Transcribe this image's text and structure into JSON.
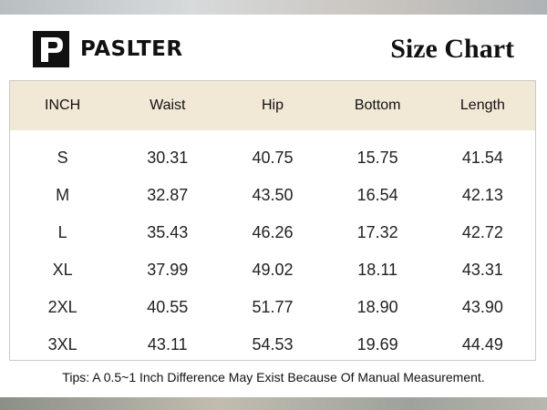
{
  "brand": {
    "name": "PASLTER",
    "logo_icon": "paslter-p-logo-icon"
  },
  "title": "Size Chart",
  "colors": {
    "header_bg": "#f2e8d6",
    "logo_bg": "#111111",
    "text": "#111111"
  },
  "table": {
    "headers": [
      "INCH",
      "Waist",
      "Hip",
      "Bottom",
      "Length"
    ],
    "rows": [
      [
        "S",
        "30.31",
        "40.75",
        "15.75",
        "41.54"
      ],
      [
        "M",
        "32.87",
        "43.50",
        "16.54",
        "42.13"
      ],
      [
        "L",
        "35.43",
        "46.26",
        "17.32",
        "42.72"
      ],
      [
        "XL",
        "37.99",
        "49.02",
        "18.11",
        "43.31"
      ],
      [
        "2XL",
        "40.55",
        "51.77",
        "18.90",
        "43.90"
      ],
      [
        "3XL",
        "43.11",
        "54.53",
        "19.69",
        "44.49"
      ]
    ]
  },
  "tips": "Tips: A 0.5~1 Inch Difference May Exist Because Of Manual Measurement."
}
